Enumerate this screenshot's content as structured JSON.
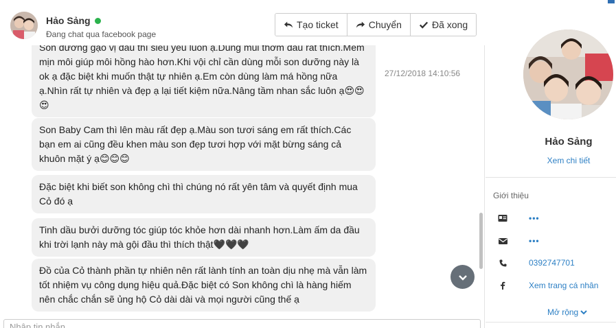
{
  "contact": {
    "name": "Hảo Sảng",
    "subtitle": "Đang chat qua facebook page",
    "status_color": "#2bb24c"
  },
  "toolbar": {
    "create_ticket_label": "Tạo ticket",
    "transfer_label": "Chuyển",
    "done_label": "Đã xong"
  },
  "messages": [
    {
      "text": "Son dưỡng gạo vị dâu thì siêu yêu luôn ạ.Dùng mùi thơm dâu rất thích.Mềm mịn môi giúp môi hồng hào hơn.Khi vội chỉ cần dùng mỗi son dưỡng này là ok ạ đặc biệt khi muốn thật tự nhiên ạ.Em còn dùng làm má hồng nữa ạ.Nhìn rất tự nhiên và đẹp ạ lại tiết kiệm nữa.Nâng tầm nhan sắc luôn ạ😍😍😍",
      "time": "27/12/2018 14:10:56"
    },
    {
      "text": "Son Baby Cam thì lên màu rất đẹp ạ.Màu son tươi sáng em rất thích.Các bạn em ai cũng đều khen màu son đẹp tươi hợp với mặt bừng sáng cả khuôn mặt ý ạ😊😊😊"
    },
    {
      "text": "Đặc biệt khi biết son không chì thì chúng nó rất yên tâm và quyết định mua Cỏ đó ạ"
    },
    {
      "text": "Tinh dầu bưởi dưỡng tóc giúp tóc khỏe hơn dài nhanh hơn.Làm ấm da đầu khi trời lạnh này mà gội đầu thì thích thật🖤🖤🖤"
    },
    {
      "text": "Đồ của Cỏ thành phần tự nhiên nên rất lành tính an toàn dịu nhẹ mà vẫn làm tốt nhiệm vụ công dụng hiệu quả.Đặc biệt có Son không chì là hàng hiếm nên chắc chắn sẽ ủng hộ Cỏ dài dài và mọi người cũng thế ạ"
    }
  ],
  "composer": {
    "placeholder": "Nhập tin nhắn..."
  },
  "profile": {
    "name": "Hảo Sảng",
    "detail_link": "Xem chi tiết",
    "section_title": "Giới thiệu",
    "id_value": "•••",
    "email_value": "•••",
    "phone": "0392747701",
    "facebook_link": "Xem trang cá nhân",
    "expand_label": "Mở rộng"
  }
}
